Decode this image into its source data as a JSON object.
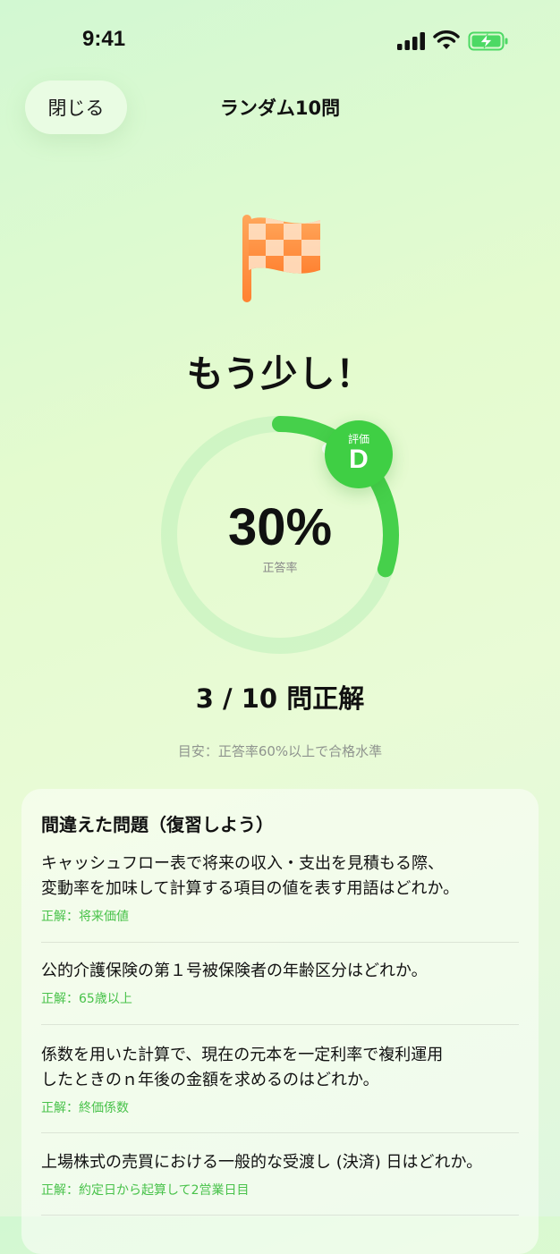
{
  "status": {
    "time": "9:41"
  },
  "nav": {
    "close_label": "閉じる",
    "title": "ランダム10問"
  },
  "result": {
    "headline": "もう少し！",
    "percent_text": "30%",
    "percent_label": "正答率",
    "progress": 0.3,
    "grade_label": "評価",
    "grade": "D",
    "score_text": "3 / 10 問正解",
    "guideline": "目安：正答率60%以上で合格水準"
  },
  "review": {
    "title": "間違えた問題（復習しよう）",
    "items": [
      {
        "question_line1": "キャッシュフロー表で将来の収入・支出を見積もる際、",
        "question_line2": "変動率を加味して計算する項目の値を表す用語はどれか。",
        "answer": "正解：将来価値"
      },
      {
        "question_line1": "公的介護保険の第１号被保険者の年齢区分はどれか。",
        "question_line2": "",
        "answer": "正解：65歳以上"
      },
      {
        "question_line1": "係数を用いた計算で、現在の元本を一定利率で複利運用",
        "question_line2": "したときのｎ年後の金額を求めるのはどれか。",
        "answer": "正解：終価係数"
      },
      {
        "question_line1": "上場株式の売買における一般的な受渡し (決済) 日はどれか。",
        "question_line2": "",
        "answer": "正解：約定日から起算して2営業日目"
      }
    ]
  },
  "colors": {
    "accent_green": "#3fcf44",
    "flag_orange": "#ff8a3d"
  },
  "icons": {
    "flag": "checkered-flag-icon",
    "signal": "cellular-signal-icon",
    "wifi": "wifi-icon",
    "battery": "battery-charging-icon"
  }
}
